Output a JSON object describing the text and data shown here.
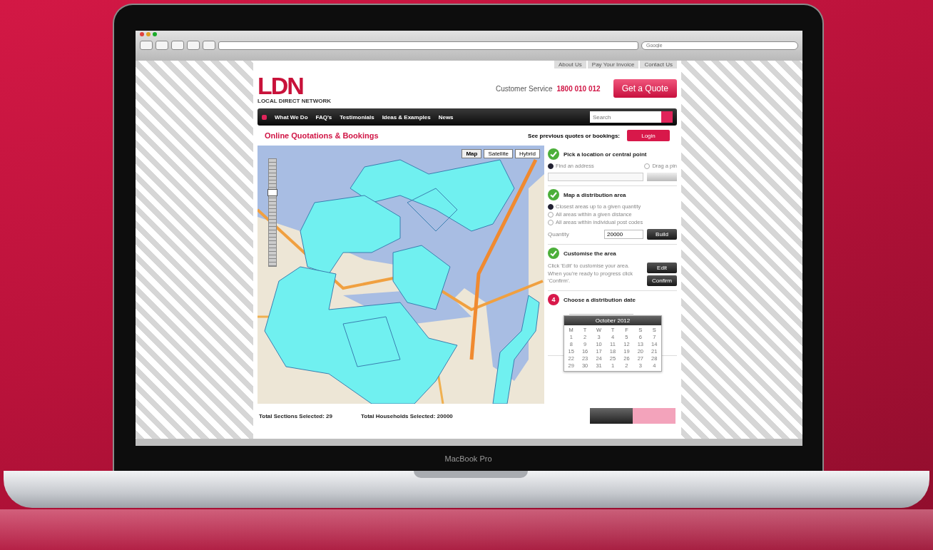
{
  "browser": {
    "search_placeholder": "Google"
  },
  "top_links": [
    "About Us",
    "Pay Your Invoice",
    "Contact Us"
  ],
  "header": {
    "logo": "LDN",
    "logo_sub": "LOCAL DIRECT NETWORK",
    "service_label": "Customer Service",
    "phone": "1800 010 012",
    "quote_button": "Get a Quote"
  },
  "nav": {
    "items": [
      "What We Do",
      "FAQ's",
      "Testimonials",
      "Ideas & Examples",
      "News"
    ],
    "search_placeholder": "Search"
  },
  "title": "Online Quotations & Bookings",
  "previous": {
    "label": "See previous quotes or bookings:",
    "button": "Login"
  },
  "map": {
    "zoom": {
      "level": 0.7
    },
    "types": [
      {
        "label": "Map",
        "selected": true
      },
      {
        "label": "Satellite",
        "selected": false
      },
      {
        "label": "Hybrid",
        "selected": false
      }
    ]
  },
  "steps": [
    {
      "kind": "done",
      "title": "Pick a location or central point"
    },
    {
      "kind": "done",
      "title": "Map a distribution area"
    },
    {
      "kind": "done",
      "title": "Customise the area"
    },
    {
      "kind": "number",
      "badge": "4",
      "title": "Choose a distribution date"
    }
  ],
  "location_options": [
    {
      "label": "Find an address",
      "selected": true
    },
    {
      "label": "Drag a pin",
      "selected": false
    }
  ],
  "area_options": [
    {
      "label": "Closest areas up to a given quantity",
      "selected": true
    },
    {
      "label": "All areas within a given distance",
      "selected": false
    },
    {
      "label": "All areas within individual post codes",
      "selected": false
    }
  ],
  "quantity": {
    "label": "Quantity",
    "value": "20000",
    "button": "Build"
  },
  "customise": {
    "text": "Click 'Edit' to customise your area. When you're ready to progress click 'Confirm'.",
    "edit_button": "Edit",
    "confirm_button": "Confirm"
  },
  "calendar": {
    "month": "October 2012",
    "weekdays": [
      "M",
      "T",
      "W",
      "T",
      "F",
      "S",
      "S"
    ],
    "weeks": [
      [
        "1",
        "2",
        "3",
        "4",
        "5",
        "6",
        "7"
      ],
      [
        "8",
        "9",
        "10",
        "11",
        "12",
        "13",
        "14"
      ],
      [
        "15",
        "16",
        "17",
        "18",
        "19",
        "20",
        "21"
      ],
      [
        "22",
        "23",
        "24",
        "25",
        "26",
        "27",
        "28"
      ],
      [
        "29",
        "30",
        "31",
        "1",
        "2",
        "3",
        "4"
      ]
    ]
  },
  "totals": [
    "Total Sections Selected: 29",
    "Total Households Selected: 20000"
  ],
  "laptop_label": "MacBook Pro"
}
